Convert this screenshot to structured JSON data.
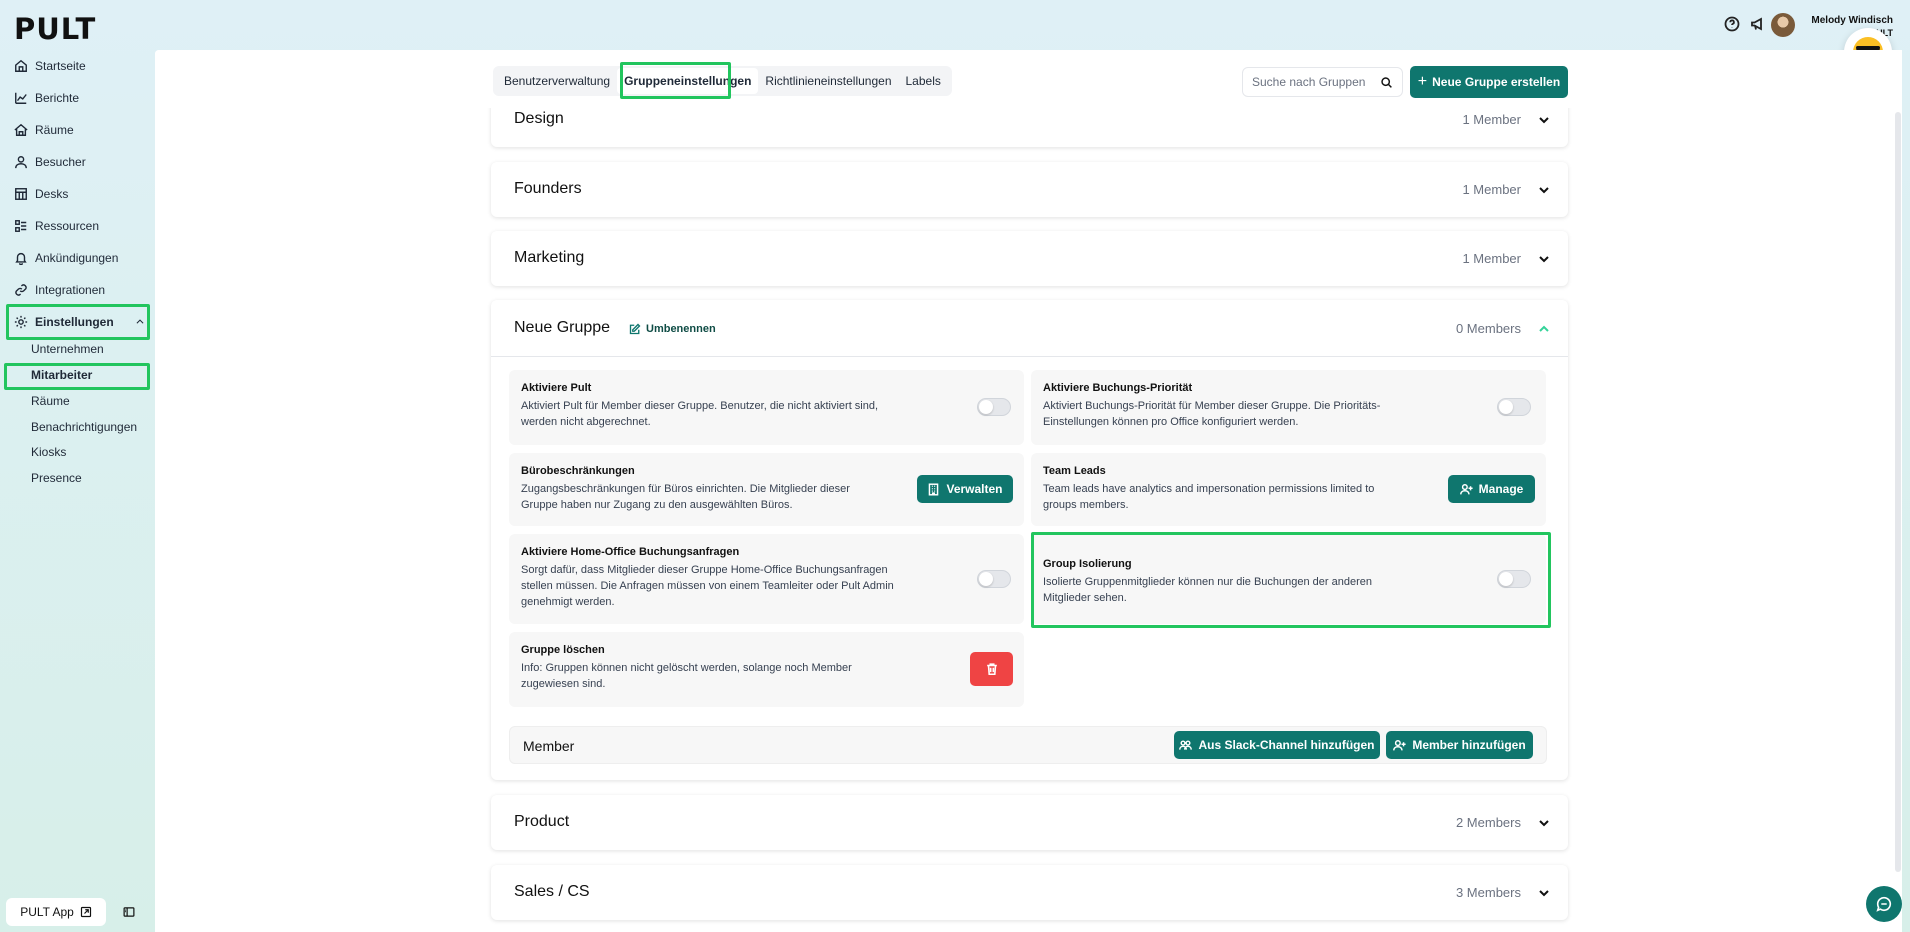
{
  "app": {
    "logo": "PULT"
  },
  "user": {
    "name": "Melody Windisch",
    "company": "PULT"
  },
  "sidebar": {
    "items": [
      {
        "label": "Startseite",
        "icon": "home-icon"
      },
      {
        "label": "Berichte",
        "icon": "chart-icon"
      },
      {
        "label": "Räume",
        "icon": "room-icon"
      },
      {
        "label": "Besucher",
        "icon": "person-icon"
      },
      {
        "label": "Desks",
        "icon": "desk-icon"
      },
      {
        "label": "Ressourcen",
        "icon": "resource-icon"
      },
      {
        "label": "Ankündigungen",
        "icon": "bell-icon"
      },
      {
        "label": "Integrationen",
        "icon": "link-icon"
      },
      {
        "label": "Einstellungen",
        "icon": "gear-icon"
      }
    ],
    "sub_items": [
      "Unternehmen",
      "Mitarbeiter",
      "Räume",
      "Benachrichtigungen",
      "Kiosks",
      "Presence"
    ],
    "app_button": "PULT App"
  },
  "tabs": [
    "Benutzerverwaltung",
    "Gruppeneinstellungen",
    "Richtlinieneinstellungen",
    "Labels"
  ],
  "search": {
    "placeholder": "Suche nach Gruppen"
  },
  "new_group_button": "Neue Gruppe erstellen",
  "groups": [
    {
      "name": "Design",
      "count": "1 Member"
    },
    {
      "name": "Founders",
      "count": "1 Member"
    },
    {
      "name": "Marketing",
      "count": "1 Member"
    },
    {
      "name": "Neue Gruppe",
      "count": "0 Members"
    },
    {
      "name": "Product",
      "count": "2 Members"
    },
    {
      "name": "Sales / CS",
      "count": "3 Members"
    }
  ],
  "expanded": {
    "rename": "Umbenennen",
    "settings": [
      {
        "title": "Aktiviere Pult",
        "desc_lines": [
          "Aktiviert Pult für Member dieser Gruppe. Benutzer, die nicht aktiviert sind,",
          "werden nicht abgerechnet."
        ]
      },
      {
        "title": "Aktiviere Buchungs-Priorität",
        "desc_lines": [
          "Aktiviert Buchungs-Priorität für Member dieser Gruppe. Die Prioritäts-",
          "Einstellungen können pro Office konfiguriert werden."
        ]
      },
      {
        "title": "Bürobeschränkungen",
        "desc_lines": [
          "Zugangsbeschränkungen für Büros einrichten. Die Mitglieder dieser",
          "Gruppe haben nur Zugang zu den ausgewählten Büros."
        ],
        "button": "Verwalten"
      },
      {
        "title": "Team Leads",
        "desc_lines": [
          "Team leads have analytics and impersonation permissions limited to",
          "groups members."
        ],
        "button": "Manage"
      },
      {
        "title": "Aktiviere Home-Office Buchungsanfragen",
        "desc_lines": [
          "Sorgt dafür, dass Mitglieder dieser Gruppe Home-Office Buchungsanfragen",
          "stellen müssen. Die Anfragen müssen von einem Teamleiter oder Pult Admin",
          "genehmigt werden."
        ]
      },
      {
        "title": "Group Isolierung",
        "desc_lines": [
          "Isolierte Gruppenmitglieder können nur die Buchungen der anderen",
          "Mitglieder sehen."
        ]
      },
      {
        "title": "Gruppe löschen",
        "desc_lines": [
          "Info: Gruppen können nicht gelöscht werden, solange noch Member",
          "zugewiesen sind."
        ]
      }
    ],
    "member_label": "Member",
    "slack_button": "Aus Slack-Channel hinzufügen",
    "add_member_button": "Member hinzufügen"
  },
  "colors": {
    "accent": "#0f766e",
    "highlight": "#22c55e",
    "danger": "#ef4444"
  }
}
